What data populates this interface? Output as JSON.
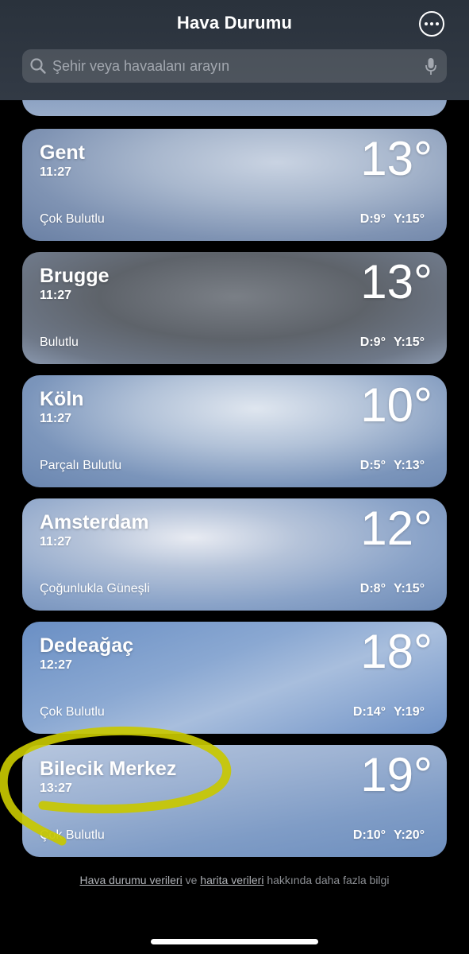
{
  "header": {
    "title": "Hava Durumu",
    "search_placeholder": "Şehir veya havaalanı arayın",
    "icons": [
      "more-icon",
      "search-icon",
      "mic-icon"
    ]
  },
  "locations": [
    {
      "city": "Gent",
      "time": "11:27",
      "temp": "13°",
      "condition": "Çok Bulutlu",
      "low": "D:9°",
      "high": "Y:15°"
    },
    {
      "city": "Brugge",
      "time": "11:27",
      "temp": "13°",
      "condition": "Bulutlu",
      "low": "D:9°",
      "high": "Y:15°"
    },
    {
      "city": "Köln",
      "time": "11:27",
      "temp": "10°",
      "condition": "Parçalı Bulutlu",
      "low": "D:5°",
      "high": "Y:13°"
    },
    {
      "city": "Amsterdam",
      "time": "11:27",
      "temp": "12°",
      "condition": "Çoğunlukla Güneşli",
      "low": "D:8°",
      "high": "Y:15°"
    },
    {
      "city": "Dedeağaç",
      "time": "12:27",
      "temp": "18°",
      "condition": "Çok Bulutlu",
      "low": "D:14°",
      "high": "Y:19°"
    },
    {
      "city": "Bilecik Merkez",
      "time": "13:27",
      "temp": "19°",
      "condition": "Çok Bulutlu",
      "low": "D:10°",
      "high": "Y:20°"
    }
  ],
  "footer": {
    "link1": "Hava durumu verileri",
    "sep": " ve ",
    "link2": "harita verileri",
    "tail": " hakkında daha fazla bilgi"
  },
  "colors": {
    "annotation": "#c8c800"
  }
}
